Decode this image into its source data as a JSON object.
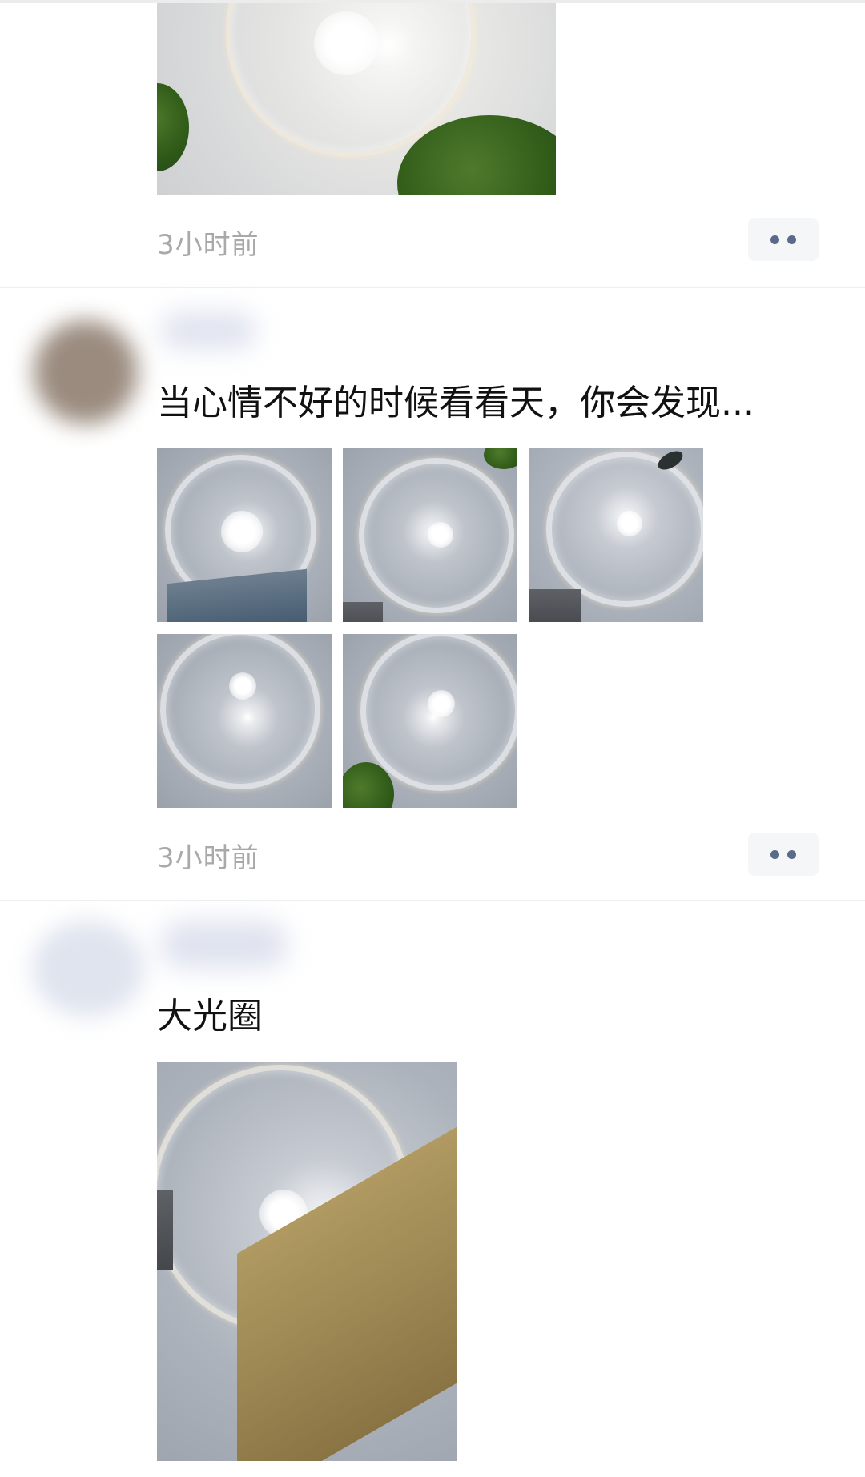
{
  "feed": {
    "posts": [
      {
        "text": "",
        "photo_count": 1,
        "timestamp": "3小时前",
        "more_icon": "more-dots-icon"
      },
      {
        "text": "当心情不好的时候看看天，你会发现...",
        "photo_count": 5,
        "timestamp": "3小时前",
        "more_icon": "more-dots-icon"
      },
      {
        "text": "大光圈",
        "photo_count": 1
      }
    ]
  },
  "colors": {
    "background": "#ffffff",
    "text": "#111111",
    "timestamp": "#a9a9a9",
    "more_button_bg": "#f5f6f8",
    "more_button_dots": "#5a6b8a",
    "divider": "#eeeeee"
  }
}
